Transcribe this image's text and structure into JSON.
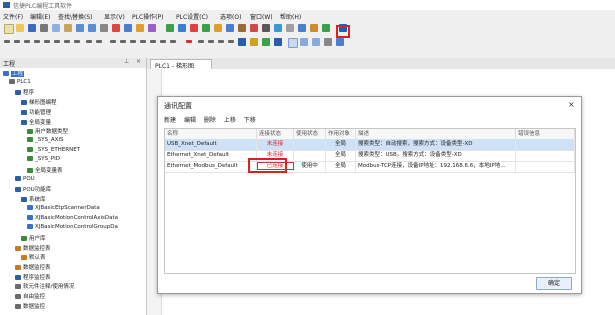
{
  "window": {
    "title": "信捷PLC编程工具软件"
  },
  "menu": [
    {
      "label": "文件(F)"
    },
    {
      "label": "编辑(E)"
    },
    {
      "label": "查找\\替换(S)"
    },
    {
      "label": "显示(V)"
    },
    {
      "label": "PLC操作(P)"
    },
    {
      "label": "PLC设置(C)"
    },
    {
      "label": "选项(O)"
    },
    {
      "label": "窗口(W)"
    },
    {
      "label": "帮助(H)"
    }
  ],
  "tree": {
    "header": "工程",
    "items": [
      {
        "label": "工程",
        "indent": 0,
        "selected": true,
        "color": "#3a6fd0"
      },
      {
        "label": "PLC1",
        "indent": 1,
        "color": "#6a6a6a"
      },
      {
        "label": "程序",
        "indent": 2,
        "color": "#2b5ea7"
      },
      {
        "label": "梯形图编程",
        "indent": 3,
        "color": "#2b5ea7"
      },
      {
        "label": "功能管理",
        "indent": 3,
        "color": "#2b5ea7"
      },
      {
        "label": "全局变量",
        "indent": 3,
        "color": "#2b5ea7"
      },
      {
        "label": "用户数据类型",
        "indent": 4,
        "color": "#3b8a3b"
      },
      {
        "label": "_SYS_AXIS",
        "indent": 4,
        "color": "#3b8a3b"
      },
      {
        "label": "_SYS_ETHERNET",
        "indent": 4,
        "color": "#3b8a3b"
      },
      {
        "label": "_SYS_PID",
        "indent": 4,
        "color": "#3b8a3b"
      },
      {
        "label": "全局变量表",
        "indent": 4,
        "color": "#3b8a3b"
      },
      {
        "label": "POU",
        "indent": 2,
        "color": "#2b5ea7"
      },
      {
        "label": "POU功能库",
        "indent": 2,
        "color": "#2b5ea7"
      },
      {
        "label": "系统库",
        "indent": 3,
        "color": "#2b5ea7"
      },
      {
        "label": "XJBasicEtpScannerData",
        "indent": 4,
        "color": "#3a6fd0"
      },
      {
        "label": "XJBasicMotionControlAxisData",
        "indent": 4,
        "color": "#3a6fd0"
      },
      {
        "label": "XJBasicMotionControlGroupDa",
        "indent": 4,
        "color": "#3a6fd0"
      },
      {
        "label": "用户库",
        "indent": 3,
        "color": "#3b8a3b"
      },
      {
        "label": "数据监控表",
        "indent": 2,
        "color": "#c87a1e"
      },
      {
        "label": "默认表",
        "indent": 3,
        "color": "#c87a1e"
      },
      {
        "label": "数据监控表",
        "indent": 2,
        "color": "#c87a1e"
      },
      {
        "label": "程序监控表",
        "indent": 2,
        "color": "#2b5ea7"
      },
      {
        "label": "软元件注释/使用情况",
        "indent": 2,
        "color": "#6a6a6a"
      },
      {
        "label": "自由监控",
        "indent": 2,
        "color": "#6a6a6a"
      },
      {
        "label": "数据监控",
        "indent": 2,
        "color": "#6a6a6a"
      }
    ]
  },
  "editor": {
    "tab_label": "PLC1 - 梯形图"
  },
  "dialog": {
    "title": "通讯配置",
    "close": "×",
    "toolbar": [
      {
        "label": "新建"
      },
      {
        "label": "编辑"
      },
      {
        "label": "删除"
      },
      {
        "label": "上移"
      },
      {
        "label": "下移"
      }
    ],
    "columns": [
      {
        "label": "名称"
      },
      {
        "label": "连接状态"
      },
      {
        "label": "使用状态"
      },
      {
        "label": "作用对象"
      },
      {
        "label": "描述"
      },
      {
        "label": "错误信息"
      }
    ],
    "rows": [
      {
        "name": "USB_Xnet_Default",
        "status": "未连接",
        "use": "",
        "scope": "全局",
        "desc": "搜索类型：自动搜索，搜索方式：设备类型-XD",
        "error": ""
      },
      {
        "name": "Ethernet_Xnet_Default",
        "status": "未连接",
        "use": "",
        "scope": "全局",
        "desc": "搜索类型：USB，搜索方式：设备类型-XD",
        "error": ""
      },
      {
        "name": "Ethernet_Modbus_Default",
        "status": "已连接",
        "use": "使用中",
        "scope": "全局",
        "desc": "Modbus-TCP连接，设备IP地址：192.168.6.6，本地IP地...",
        "error": ""
      }
    ],
    "ok_button": "确定"
  }
}
